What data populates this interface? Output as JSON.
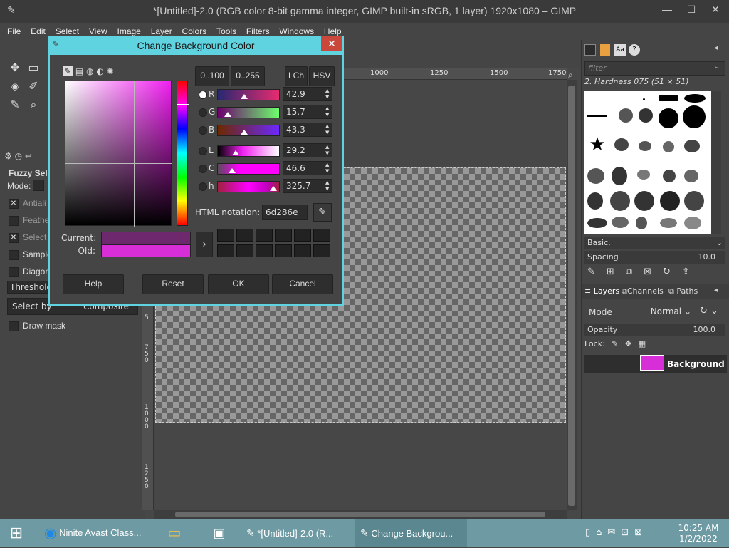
{
  "window": {
    "title": "*[Untitled]-2.0 (RGB color 8-bit gamma integer, GIMP built-in sRGB, 1 layer) 1920x1080 – GIMP",
    "min": "—",
    "max": "☐",
    "close": "✕"
  },
  "menu": [
    "File",
    "Edit",
    "Select",
    "View",
    "Image",
    "Layer",
    "Colors",
    "Tools",
    "Filters",
    "Windows",
    "Help"
  ],
  "toolbox": {
    "tool_title": "Fuzzy Sele",
    "mode_label": "Mode:",
    "antialias": "Antiali",
    "feather": "Feathe",
    "select_transparent": "Select t",
    "sample_merged": "Sample",
    "diagonal": "Diagona",
    "threshold": "Threshold",
    "select_by": "Select by",
    "select_by_value": "Composite",
    "draw_mask": "Draw mask",
    "ruler_v": [
      "5",
      "7 5 0",
      "1 0 0 0",
      "1 2 5 0"
    ]
  },
  "ruler_h": [
    "1000",
    "1250",
    "1500",
    "1750"
  ],
  "dialog": {
    "title": "Change Background Color",
    "close": "✕",
    "range_100": "0..100",
    "range_255": "0..255",
    "lch": "LCh",
    "hsv": "HSV",
    "sliders": [
      {
        "label": "R",
        "value": "42.9",
        "fraction": 0.429
      },
      {
        "label": "G",
        "value": "15.7",
        "fraction": 0.157
      },
      {
        "label": "B",
        "value": "43.3",
        "fraction": 0.433
      },
      {
        "label": "L",
        "value": "29.2",
        "fraction": 0.292
      },
      {
        "label": "C",
        "value": "46.6",
        "fraction": 0.233
      },
      {
        "label": "h",
        "value": "325.7",
        "fraction": 0.905
      }
    ],
    "html_label": "HTML notation:",
    "html_value": "6d286e",
    "current_label": "Current:",
    "old_label": "Old:",
    "current_color": "#6d286e",
    "old_color": "#d72ed7",
    "buttons": {
      "help": "Help",
      "reset": "Reset",
      "ok": "OK",
      "cancel": "Cancel"
    }
  },
  "dock": {
    "filter_placeholder": "filter",
    "brush_name": "2. Hardness 075 (51 × 51)",
    "brush_set": "Basic,",
    "spacing_label": "Spacing",
    "spacing_value": "10.0",
    "tabs": {
      "layers": "Layers",
      "channels": "Channels",
      "paths": "Paths"
    },
    "mode_label": "Mode",
    "mode_value": "Normal",
    "opacity_label": "Opacity",
    "opacity_value": "100.0",
    "lock_label": "Lock:",
    "layer_name": "Background",
    "layer_color": "#d72ed7"
  },
  "taskbar": {
    "items": [
      "Ninite Avast Class...",
      "*[Untitled]-2.0 (R...",
      "Change Backgrou..."
    ],
    "time": "10:25 AM",
    "date": "1/2/2022"
  }
}
